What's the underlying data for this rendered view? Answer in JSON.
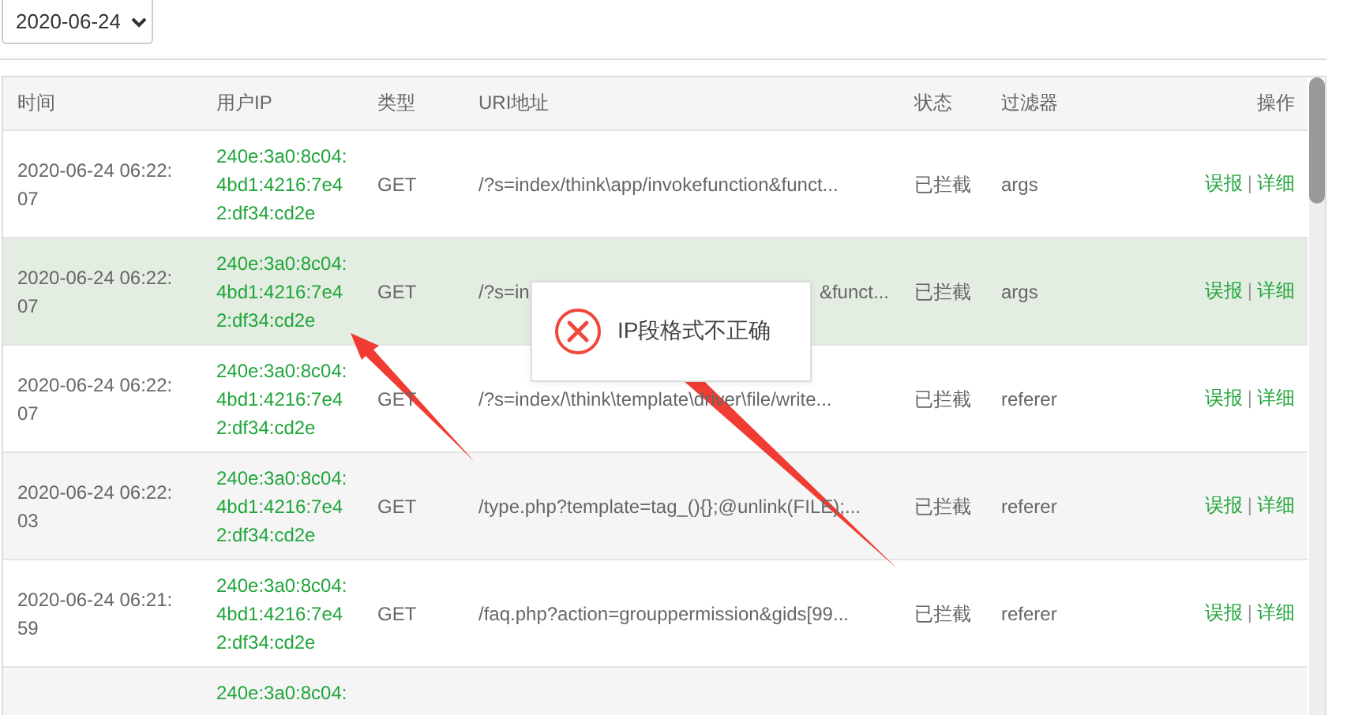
{
  "date_select": {
    "value": "2020-06-24"
  },
  "table": {
    "columns": [
      "时间",
      "用户IP",
      "类型",
      "URI地址",
      "状态",
      "过滤器",
      "操作"
    ],
    "action_separator": "|",
    "rows": [
      {
        "time": "2020-06-24 06:22:07",
        "ip": "240e:3a0:8c04:4bd1:4216:7e42:df34:cd2e",
        "type": "GET",
        "uri": "/?s=index/think\\app/invokefunction&funct...",
        "status": "已拦截",
        "filter": "args",
        "actions": [
          "误报",
          "详细"
        ],
        "selected": false
      },
      {
        "time": "2020-06-24 06:22:07",
        "ip": "240e:3a0:8c04:4bd1:4216:7e42:df34:cd2e",
        "type": "GET",
        "uri_parts": [
          "/?s=in",
          "&funct..."
        ],
        "status": "已拦截",
        "filter": "args",
        "actions": [
          "误报",
          "详细"
        ],
        "selected": true
      },
      {
        "time": "2020-06-24 06:22:07",
        "ip": "240e:3a0:8c04:4bd1:4216:7e42:df34:cd2e",
        "type": "GET",
        "uri": "/?s=index/\\think\\template\\driver\\file/write...",
        "status": "已拦截",
        "filter": "referer",
        "actions": [
          "误报",
          "详细"
        ],
        "selected": false
      },
      {
        "time": "2020-06-24 06:22:03",
        "ip": "240e:3a0:8c04:4bd1:4216:7e42:df34:cd2e",
        "type": "GET",
        "uri": "/type.php?template=tag_(){};@unlink(FILE);...",
        "status": "已拦截",
        "filter": "referer",
        "actions": [
          "误报",
          "详细"
        ],
        "selected": false
      },
      {
        "time": "2020-06-24 06:21:59",
        "ip": "240e:3a0:8c04:4bd1:4216:7e42:df34:cd2e",
        "type": "GET",
        "uri": "/faq.php?action=grouppermission&gids[99...",
        "status": "已拦截",
        "filter": "referer",
        "actions": [
          "误报",
          "详细"
        ],
        "selected": false
      },
      {
        "ip": "240e:3a0:8c04:",
        "selected": false
      }
    ]
  },
  "toast": {
    "kind": "error",
    "message": "IP段格式不正确"
  }
}
